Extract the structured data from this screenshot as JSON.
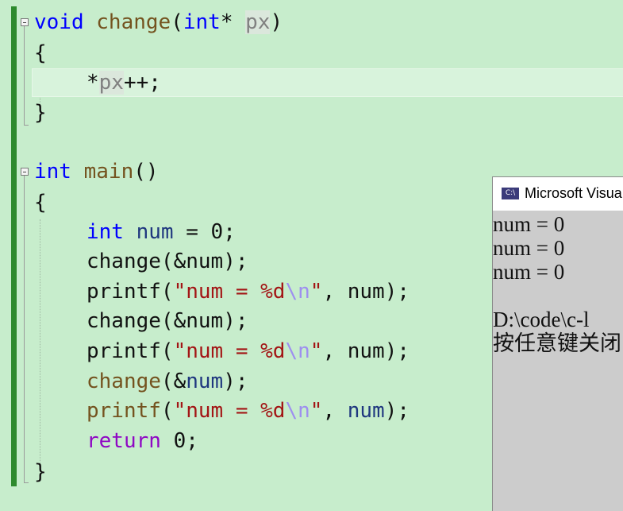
{
  "editor": {
    "lines": [
      [
        "void",
        " ",
        "change",
        "(",
        "int",
        "*",
        " ",
        "px",
        ")"
      ],
      [
        "{"
      ],
      [
        "*",
        "px",
        "++;"
      ],
      [
        "}"
      ],
      [],
      [
        "int",
        " ",
        "main",
        "()"
      ],
      [
        "{"
      ],
      [
        "int",
        " ",
        "num",
        " = 0;"
      ],
      [
        "change",
        "(&num);"
      ],
      [
        "printf",
        "(",
        "\"num = %d",
        "\\n",
        "\"",
        ", num);"
      ],
      [
        "change",
        "(&num);"
      ],
      [
        "printf",
        "(",
        "\"num = %d",
        "\\n",
        "\"",
        ", num);"
      ],
      [
        "change",
        "(&",
        "num",
        ");"
      ],
      [
        "printf",
        "(",
        "\"num = %d",
        "\\n",
        "\"",
        ", ",
        "num",
        ");"
      ],
      [
        "return",
        " 0;"
      ],
      [
        "}"
      ]
    ]
  },
  "console": {
    "title": "Microsoft Visua",
    "icon_label": "C:\\",
    "lines": [
      "num = 0",
      "num = 0",
      "num = 0",
      "",
      "D:\\code\\c-l",
      "按任意键关闭"
    ]
  },
  "colors": {
    "background": "#c7edcc",
    "keyword": "#0000ff",
    "control_keyword": "#8f08c4",
    "function": "#74531f",
    "variable": "#1f377f",
    "string": "#a31515",
    "escape": "#9e8fef",
    "change_marker": "#2d8a2d"
  }
}
